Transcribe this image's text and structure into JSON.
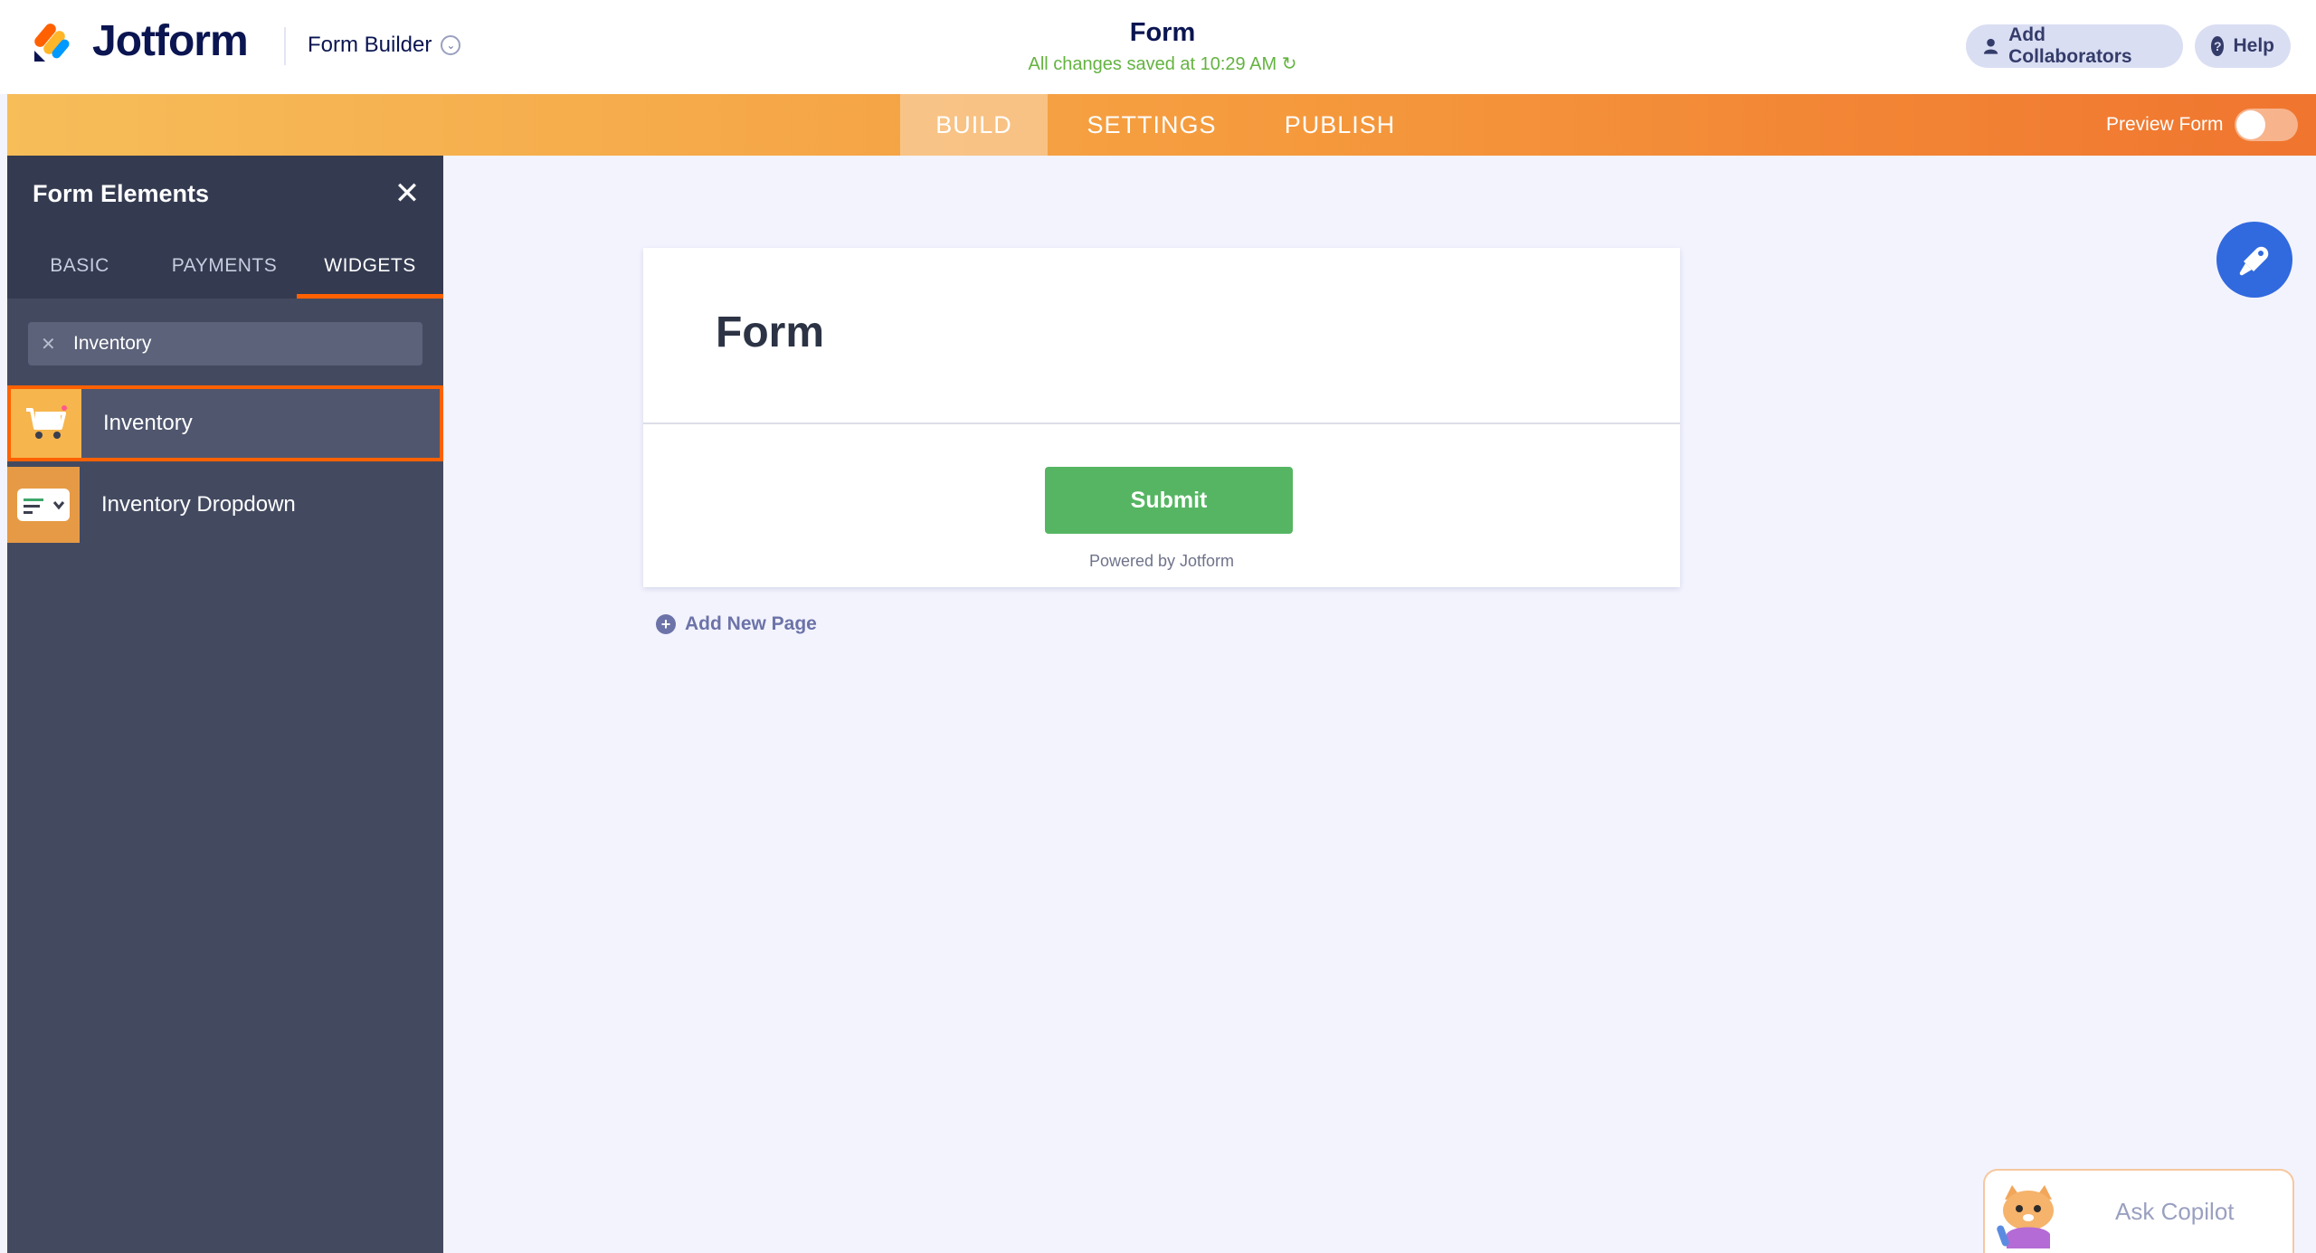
{
  "header": {
    "brand": "Jotform",
    "builder_menu": "Form Builder",
    "form_title": "Form",
    "saved_status": "All changes saved at 10:29 AM",
    "add_collaborators": "Add Collaborators",
    "help": "Help"
  },
  "nav": {
    "tabs": [
      {
        "label": "BUILD",
        "active": true
      },
      {
        "label": "SETTINGS",
        "active": false
      },
      {
        "label": "PUBLISH",
        "active": false
      }
    ],
    "preview_label": "Preview Form",
    "preview_on": false
  },
  "sidebar": {
    "title": "Form Elements",
    "tabs": [
      {
        "label": "BASIC"
      },
      {
        "label": "PAYMENTS"
      },
      {
        "label": "WIDGETS",
        "active": true
      }
    ],
    "search_value": "Inventory",
    "items": [
      {
        "label": "Inventory",
        "icon": "shopping-cart-icon",
        "selected": true
      },
      {
        "label": "Inventory Dropdown",
        "icon": "dropdown-widget-icon",
        "selected": false
      }
    ]
  },
  "form": {
    "heading": "Form",
    "submit_label": "Submit",
    "powered_by": "Powered by Jotform",
    "add_page": "Add New Page"
  },
  "copilot": {
    "label": "Ask Copilot"
  },
  "colors": {
    "accent_orange": "#ff6100",
    "submit_green": "#56b563",
    "designer_blue": "#3169de",
    "saved_green": "#64b340",
    "navy": "#0a1551"
  }
}
